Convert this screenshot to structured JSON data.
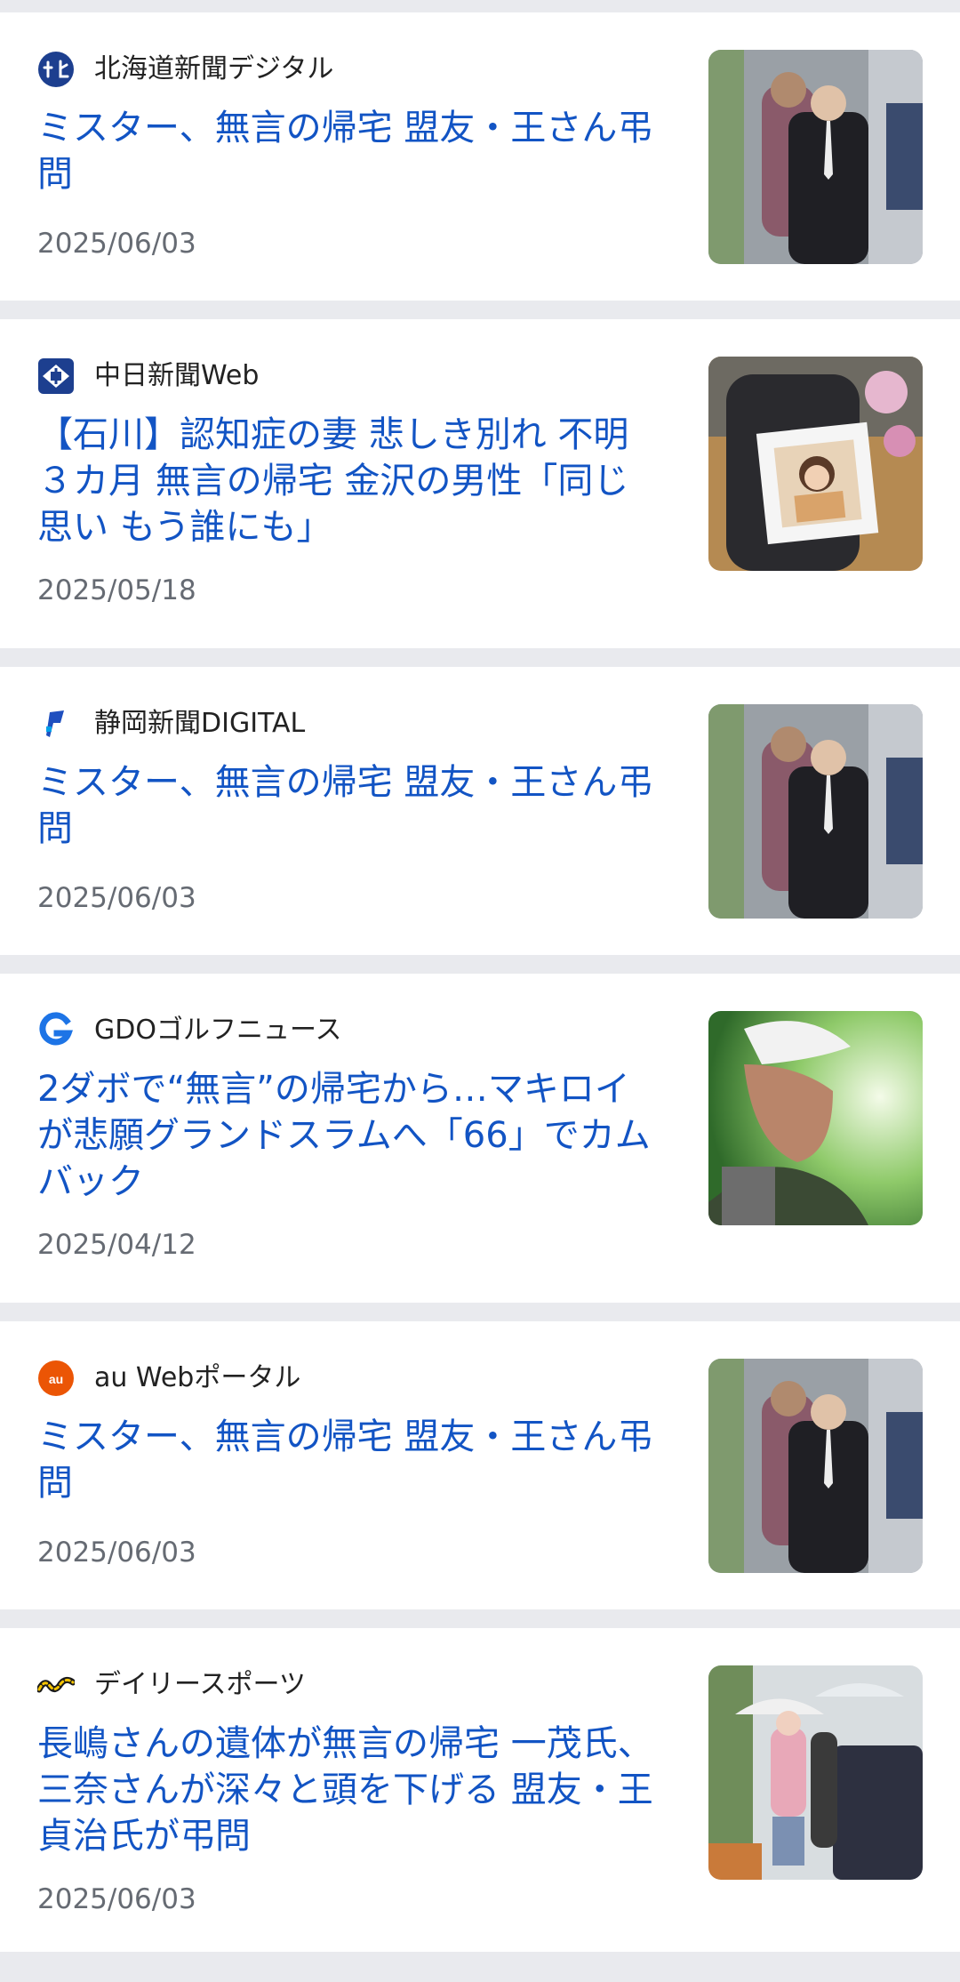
{
  "articles": [
    {
      "source": "北海道新聞デジタル",
      "source_icon": "hokkaido-shimbun-logo-icon",
      "headline": "ミスター、無言の帰宅 盟友・王さん弔問",
      "date": "2025/06/03",
      "thumbnail": "photo-men-walking"
    },
    {
      "source": "中日新聞Web",
      "source_icon": "chunichi-shimbun-logo-icon",
      "headline": "【石川】認知症の妻 悲しき別れ 不明３カ月 無言の帰宅 金沢の男性「同じ思い もう誰にも」",
      "date": "2025/05/18",
      "thumbnail": "photo-portrait-frame"
    },
    {
      "source": "静岡新聞DIGITAL",
      "source_icon": "shizuoka-shimbun-logo-icon",
      "headline": "ミスター、無言の帰宅 盟友・王さん弔問",
      "date": "2025/06/03",
      "thumbnail": "photo-men-walking"
    },
    {
      "source": "GDOゴルフニュース",
      "source_icon": "gdo-logo-icon",
      "headline": "2ダボで“無言”の帰宅から…マキロイが悲願グランドスラムへ「66」でカムバック",
      "date": "2025/04/12",
      "thumbnail": "photo-golfer"
    },
    {
      "source": "au Webポータル",
      "source_icon": "au-web-portal-logo-icon",
      "headline": "ミスター、無言の帰宅 盟友・王さん弔問",
      "date": "2025/06/03",
      "thumbnail": "photo-men-walking"
    },
    {
      "source": "デイリースポーツ",
      "source_icon": "daily-sports-logo-icon",
      "headline": "長嶋さんの遺体が無言の帰宅 一茂氏、三奈さんが深々と頭を下げる 盟友・王貞治氏が弔問",
      "date": "2025/06/03",
      "thumbnail": "photo-umbrellas"
    }
  ],
  "colors": {
    "headline": "#1254c4",
    "separator": "#e9eaee",
    "date": "#666b73"
  }
}
